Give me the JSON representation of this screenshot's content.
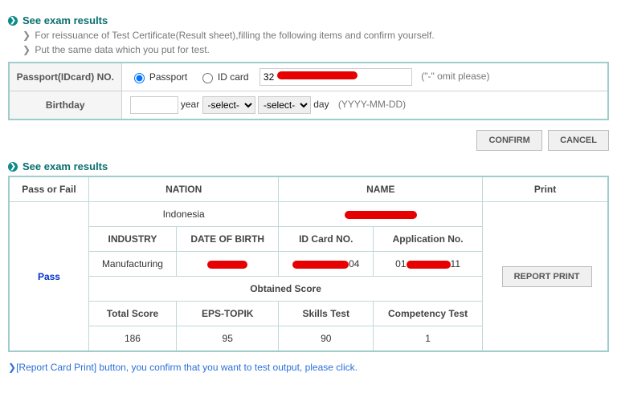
{
  "header": {
    "title": "See exam results",
    "note1": "For reissuance of Test Certificate(Result sheet),filling the following items and confirm yourself.",
    "note2": "Put the same data which you put for test."
  },
  "form": {
    "passport_label": "Passport(IDcard) NO.",
    "radio_passport": "Passport",
    "radio_idcard": "ID card",
    "id_value_prefix": "32",
    "id_hint": "(\"-\" omit please)",
    "birthday_label": "Birthday",
    "year_placeholder": "",
    "year_text": "year",
    "month_select": "-select-",
    "day_select": "-select-",
    "day_text": "day",
    "date_hint": "(YYYY-MM-DD)"
  },
  "buttons": {
    "confirm": "CONFIRM",
    "cancel": "CANCEL",
    "report_print": "REPORT PRINT"
  },
  "results_header": "See exam results",
  "results": {
    "col_passfail": "Pass or Fail",
    "col_nation": "NATION",
    "col_name": "NAME",
    "col_print": "Print",
    "nation_value": "Indonesia",
    "pass_value": "Pass",
    "industry_h": "INDUSTRY",
    "dob_h": "DATE OF BIRTH",
    "idcard_h": "ID Card NO.",
    "appno_h": "Application No.",
    "industry_v": "Manufacturing",
    "idcard_suffix": "04",
    "appno_prefix": "01",
    "appno_suffix": "11",
    "obtained_h": "Obtained Score",
    "total_h": "Total Score",
    "eps_h": "EPS-TOPIK",
    "skills_h": "Skills Test",
    "comp_h": "Competency Test",
    "total_v": "186",
    "eps_v": "95",
    "skills_v": "90",
    "comp_v": "1"
  },
  "footnote": "[Report Card Print] button, you confirm that you want to test output, please click."
}
